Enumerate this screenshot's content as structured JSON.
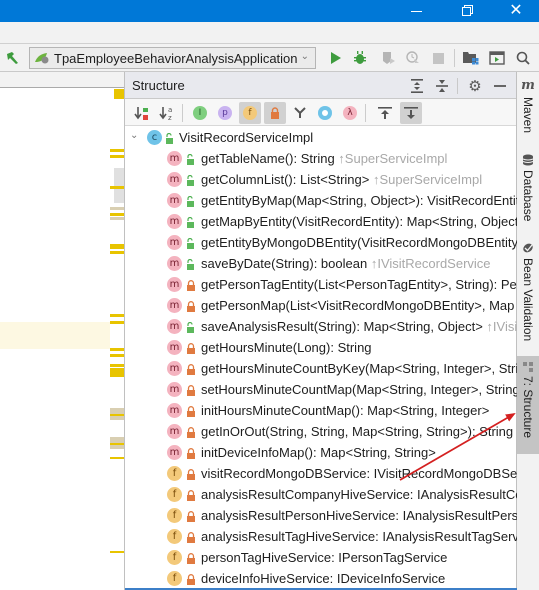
{
  "window": {
    "minimize_icon": "minimize-icon",
    "maximize_icon": "restore-icon",
    "close_icon": "close-icon"
  },
  "toolbar": {
    "run_config": "TpaEmployeeBehaviorAnalysisApplication",
    "icons": [
      "build-hammer-icon",
      "run-icon",
      "debug-icon",
      "coverage-icon",
      "profile-icon",
      "stop-icon",
      "project-structure-icon",
      "terminal-icon",
      "search-icon"
    ]
  },
  "structure_panel": {
    "title": "Structure",
    "header_icons": [
      "expand-all-icon",
      "collapse-all-icon",
      "gear-icon",
      "hide-icon"
    ],
    "tools": [
      {
        "name": "sort-by-visibility",
        "active": false
      },
      {
        "name": "sort-alphabetically",
        "active": false
      },
      {
        "name": "show-inherited",
        "active": false
      },
      {
        "name": "show-properties",
        "active": false
      },
      {
        "name": "show-fields",
        "active": true
      },
      {
        "name": "show-non-public",
        "active": true
      },
      {
        "name": "show-includes",
        "active": false
      },
      {
        "name": "show-anonymous",
        "active": false
      },
      {
        "name": "show-lambdas",
        "active": false
      },
      {
        "name": "autoscroll-to-source",
        "active": false
      },
      {
        "name": "autoscroll-from-source",
        "active": true
      }
    ],
    "root": {
      "kind": "c",
      "visibility": "public",
      "label": "VisitRecordServiceImpl"
    },
    "items": [
      {
        "kind": "m",
        "visibility": "public",
        "label": "getTableName(): String",
        "inherit": "↑SuperServiceImpl"
      },
      {
        "kind": "m",
        "visibility": "public",
        "label": "getColumnList(): List<String>",
        "inherit": "↑SuperServiceImpl"
      },
      {
        "kind": "m",
        "visibility": "public",
        "label": "getEntityByMap(Map<String, Object>): VisitRecordEntity",
        "inherit": ""
      },
      {
        "kind": "m",
        "visibility": "public",
        "label": "getMapByEntity(VisitRecordEntity): Map<String, Object>",
        "inherit": ""
      },
      {
        "kind": "m",
        "visibility": "public",
        "label": "getEntityByMongoDBEntity(VisitRecordMongoDBEntity)",
        "inherit": ""
      },
      {
        "kind": "m",
        "visibility": "public",
        "label": "saveByDate(String): boolean",
        "inherit": "↑IVisitRecordService"
      },
      {
        "kind": "m",
        "visibility": "private",
        "label": "getPersonTagEntity(List<PersonTagEntity>, String): PersonTagEntity",
        "inherit": ""
      },
      {
        "kind": "m",
        "visibility": "private",
        "label": "getPersonMap(List<VisitRecordMongoDBEntity>, Map",
        "inherit": ""
      },
      {
        "kind": "m",
        "visibility": "public",
        "label": "saveAnalysisResult(String): Map<String, Object>",
        "inherit": "↑IVisitRecordService"
      },
      {
        "kind": "m",
        "visibility": "private",
        "label": "getHoursMinute(Long): String",
        "inherit": ""
      },
      {
        "kind": "m",
        "visibility": "private",
        "label": "getHoursMinuteCountByKey(Map<String, Integer>, String",
        "inherit": ""
      },
      {
        "kind": "m",
        "visibility": "private",
        "label": "setHoursMinuteCountMap(Map<String, Integer>, String",
        "inherit": ""
      },
      {
        "kind": "m",
        "visibility": "private",
        "label": "initHoursMinuteCountMap(): Map<String, Integer>",
        "inherit": ""
      },
      {
        "kind": "m",
        "visibility": "private",
        "label": "getInOrOut(String, String, Map<String, String>): String",
        "inherit": ""
      },
      {
        "kind": "m",
        "visibility": "private",
        "label": "initDeviceInfoMap(): Map<String, String>",
        "inherit": ""
      },
      {
        "kind": "f",
        "visibility": "private",
        "label": "visitRecordMongoDBService: IVisitRecordMongoDBService",
        "inherit": ""
      },
      {
        "kind": "f",
        "visibility": "private",
        "label": "analysisResultCompanyHiveService: IAnalysisResultCompanyService",
        "inherit": ""
      },
      {
        "kind": "f",
        "visibility": "private",
        "label": "analysisResultPersonHiveService: IAnalysisResultPersonService",
        "inherit": ""
      },
      {
        "kind": "f",
        "visibility": "private",
        "label": "analysisResultTagHiveService: IAnalysisResultTagService",
        "inherit": ""
      },
      {
        "kind": "f",
        "visibility": "private",
        "label": "personTagHiveService: IPersonTagService",
        "inherit": ""
      },
      {
        "kind": "f",
        "visibility": "private",
        "label": "deviceInfoHiveService: IDeviceInfoService",
        "inherit": ""
      }
    ]
  },
  "right_toolbar": {
    "tabs": [
      {
        "label": "Maven",
        "icon": "maven-icon",
        "active": false
      },
      {
        "label": "Database",
        "icon": "database-icon",
        "active": false
      },
      {
        "label": "Bean Validation",
        "icon": "bean-validation-icon",
        "active": false
      },
      {
        "label": "7: Structure",
        "icon": "structure-icon",
        "active": true
      }
    ]
  },
  "colors": {
    "titlebar": "#0078d7",
    "annotation_arrow": "#d42020",
    "method_badge": "#f4b3bf",
    "field_badge": "#f3c97a",
    "class_badge": "#6fc3e8",
    "marker_yellow": "#e8c400"
  }
}
